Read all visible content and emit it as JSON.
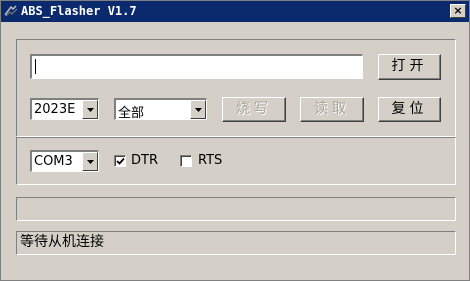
{
  "window": {
    "title": "ABS_Flasher V1.7",
    "close_glyph": "×"
  },
  "file": {
    "path_value": "",
    "open_label": "打开"
  },
  "controls": {
    "year_value": "2023E",
    "mode_value": "全部",
    "burn_label": "烧写",
    "read_label": "读取",
    "reset_label": "复位",
    "burn_enabled": false,
    "read_enabled": false
  },
  "serial": {
    "port_value": "COM3",
    "dtr_label": "DTR",
    "dtr_checked": true,
    "rts_label": "RTS",
    "rts_checked": false
  },
  "progress": {
    "value_percent": 0
  },
  "status": {
    "text": "等待从机连接"
  },
  "colors": {
    "titlebar": "#0b2a6e",
    "face": "#d4d0c8",
    "disabled_text": "#a8a49c"
  }
}
